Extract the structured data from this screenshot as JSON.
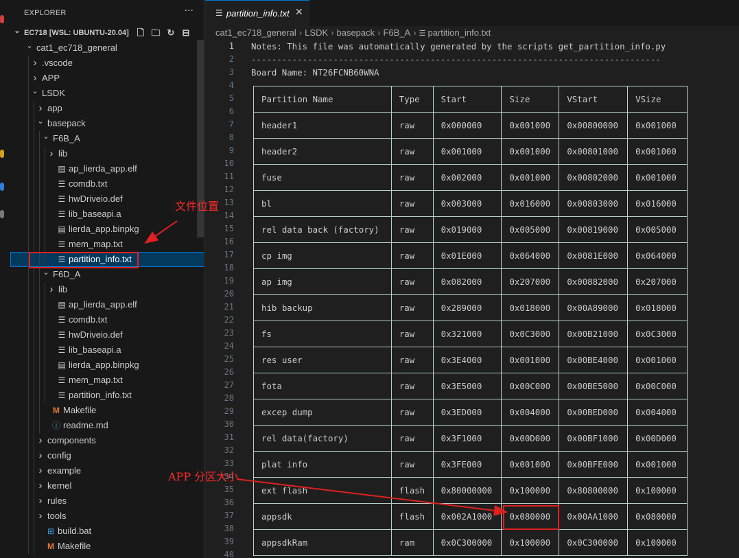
{
  "activity_bar": {
    "icons": [
      "explorer-icon",
      "debug-icon",
      "remote-icon",
      "source-control-icon"
    ]
  },
  "sidebar": {
    "title": "EXPLORER",
    "more": "···",
    "root_label": "EC718 [WSL: UBUNTU-20.04]",
    "root_actions": [
      "new-file-icon",
      "new-folder-icon",
      "refresh-icon",
      "collapse-all-icon"
    ],
    "tree": [
      {
        "label": "cat1_ec718_general",
        "depth": 1,
        "kind": "folder-open"
      },
      {
        "label": ".vscode",
        "depth": 2,
        "kind": "folder"
      },
      {
        "label": "APP",
        "depth": 2,
        "kind": "folder"
      },
      {
        "label": "LSDK",
        "depth": 2,
        "kind": "folder-open"
      },
      {
        "label": "app",
        "depth": 3,
        "kind": "folder"
      },
      {
        "label": "basepack",
        "depth": 3,
        "kind": "folder-open"
      },
      {
        "label": "F6B_A",
        "depth": 4,
        "kind": "folder-open"
      },
      {
        "label": "lib",
        "depth": 5,
        "kind": "folder"
      },
      {
        "label": "ap_lierda_app.elf",
        "depth": 5,
        "kind": "file"
      },
      {
        "label": "comdb.txt",
        "depth": 5,
        "kind": "text"
      },
      {
        "label": "hwDriveio.def",
        "depth": 5,
        "kind": "text"
      },
      {
        "label": "lib_baseapi.a",
        "depth": 5,
        "kind": "text"
      },
      {
        "label": "lierda_app.binpkg",
        "depth": 5,
        "kind": "file"
      },
      {
        "label": "mem_map.txt",
        "depth": 5,
        "kind": "text"
      },
      {
        "label": "partition_info.txt",
        "depth": 5,
        "kind": "text",
        "selected": true
      },
      {
        "label": "F6D_A",
        "depth": 4,
        "kind": "folder-open"
      },
      {
        "label": "lib",
        "depth": 5,
        "kind": "folder"
      },
      {
        "label": "ap_lierda_app.elf",
        "depth": 5,
        "kind": "file"
      },
      {
        "label": "comdb.txt",
        "depth": 5,
        "kind": "text"
      },
      {
        "label": "hwDriveio.def",
        "depth": 5,
        "kind": "text"
      },
      {
        "label": "lib_baseapi.a",
        "depth": 5,
        "kind": "text"
      },
      {
        "label": "lierda_app.binpkg",
        "depth": 5,
        "kind": "file"
      },
      {
        "label": "mem_map.txt",
        "depth": 5,
        "kind": "text"
      },
      {
        "label": "partition_info.txt",
        "depth": 5,
        "kind": "text"
      },
      {
        "label": "Makefile",
        "depth": 4,
        "kind": "makefile"
      },
      {
        "label": "readme.md",
        "depth": 4,
        "kind": "info"
      },
      {
        "label": "components",
        "depth": 3,
        "kind": "folder"
      },
      {
        "label": "config",
        "depth": 3,
        "kind": "folder"
      },
      {
        "label": "example",
        "depth": 3,
        "kind": "folder"
      },
      {
        "label": "kernel",
        "depth": 3,
        "kind": "folder"
      },
      {
        "label": "rules",
        "depth": 3,
        "kind": "folder"
      },
      {
        "label": "tools",
        "depth": 3,
        "kind": "folder"
      },
      {
        "label": "build.bat",
        "depth": 3,
        "kind": "windows"
      },
      {
        "label": "Makefile",
        "depth": 3,
        "kind": "makefile"
      }
    ]
  },
  "editor": {
    "tab": {
      "label": "partition_info.txt",
      "close": "✕"
    },
    "breadcrumb": [
      "cat1_ec718_general",
      "LSDK",
      "basepack",
      "F6B_A",
      "partition_info.txt"
    ],
    "lines": [
      "Notes: This file was automatically generated by the scripts get_partition_info.py",
      "--------------------------------------------------------------------------------",
      "Board Name: NT26FCNB60WNA"
    ],
    "line_numbers": [
      "1",
      "2",
      "3",
      "4",
      "5",
      "6",
      "7",
      "8",
      "9",
      "10",
      "11",
      "12",
      "13",
      "14",
      "15",
      "16",
      "17",
      "18",
      "19",
      "20",
      "21",
      "22",
      "23",
      "24",
      "25",
      "26",
      "27",
      "28",
      "29",
      "30",
      "31",
      "32",
      "33",
      "34",
      "35",
      "36",
      "37",
      "38",
      "39",
      "40"
    ],
    "table": {
      "headers": [
        "Partition Name",
        "Type",
        "Start",
        "Size",
        "VStart",
        "VSize"
      ],
      "rows": [
        [
          "header1",
          "raw",
          "0x000000",
          "0x001000",
          "0x00800000",
          "0x001000"
        ],
        [
          "header2",
          "raw",
          "0x001000",
          "0x001000",
          "0x00801000",
          "0x001000"
        ],
        [
          "fuse",
          "raw",
          "0x002000",
          "0x001000",
          "0x00802000",
          "0x001000"
        ],
        [
          "bl",
          "raw",
          "0x003000",
          "0x016000",
          "0x00803000",
          "0x016000"
        ],
        [
          "rel data back (factory)",
          "raw",
          "0x019000",
          "0x005000",
          "0x00819000",
          "0x005000"
        ],
        [
          "cp img",
          "raw",
          "0x01E000",
          "0x064000",
          "0x0081E000",
          "0x064000"
        ],
        [
          "ap img",
          "raw",
          "0x082000",
          "0x207000",
          "0x00882000",
          "0x207000"
        ],
        [
          "hib backup",
          "raw",
          "0x289000",
          "0x018000",
          "0x00A89000",
          "0x018000"
        ],
        [
          "fs",
          "raw",
          "0x321000",
          "0x0C3000",
          "0x00B21000",
          "0x0C3000"
        ],
        [
          "res user",
          "raw",
          "0x3E4000",
          "0x001000",
          "0x00BE4000",
          "0x001000"
        ],
        [
          "fota",
          "raw",
          "0x3E5000",
          "0x00C000",
          "0x00BE5000",
          "0x00C000"
        ],
        [
          "excep dump",
          "raw",
          "0x3ED000",
          "0x004000",
          "0x00BED000",
          "0x004000"
        ],
        [
          "rel data(factory)",
          "raw",
          "0x3F1000",
          "0x00D000",
          "0x00BF1000",
          "0x00D000"
        ],
        [
          "plat info",
          "raw",
          "0x3FE000",
          "0x001000",
          "0x00BFE000",
          "0x001000"
        ],
        [
          "ext flash",
          "flash",
          "0x80000000",
          "0x100000",
          "0x80800000",
          "0x100000"
        ],
        [
          "appsdk",
          "flash",
          "0x002A1000",
          "0x080000",
          "0x00AA1000",
          "0x080000"
        ],
        [
          "appsdkRam",
          "ram",
          "0x0C300000",
          "0x100000",
          "0x0C300000",
          "0x100000"
        ]
      ]
    }
  },
  "annotations": {
    "file_location": "文件位置",
    "app_partition_size": "APP 分区大小",
    "color": "#ff2a2a"
  }
}
